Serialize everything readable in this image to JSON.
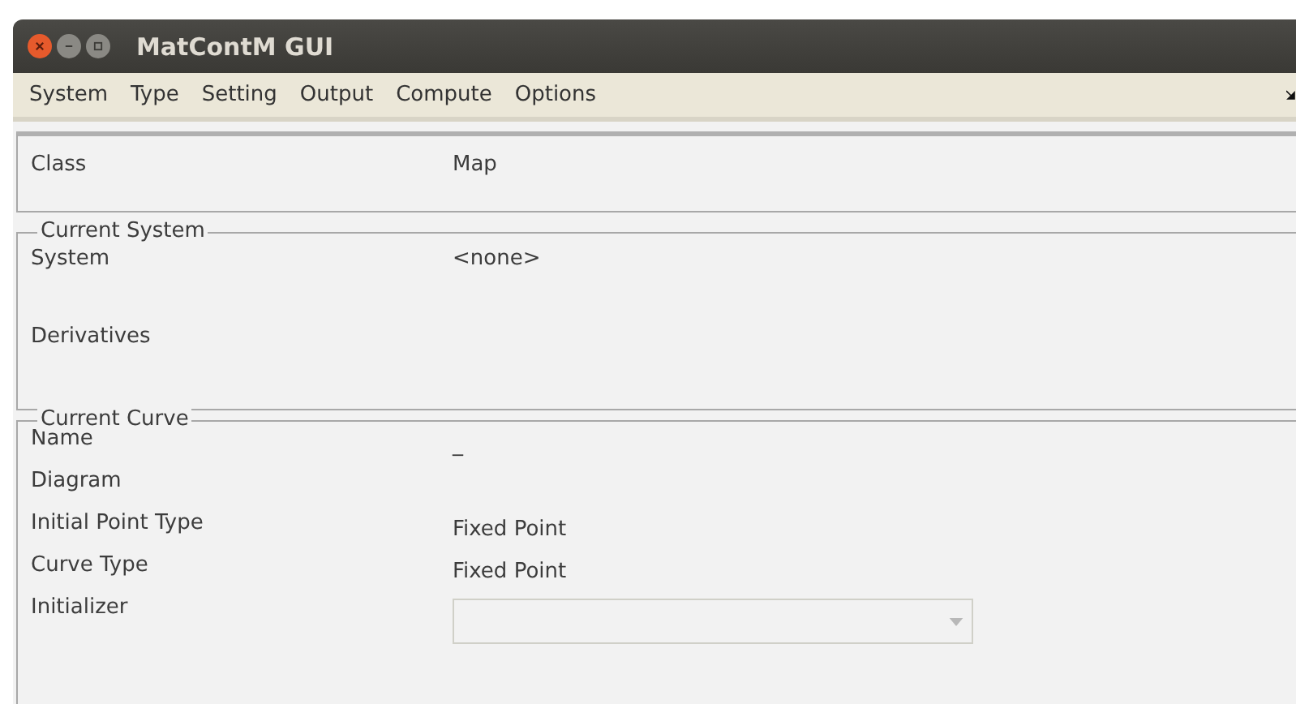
{
  "window": {
    "title": "MatContM GUI"
  },
  "menu": [
    {
      "label": "System"
    },
    {
      "label": "Type"
    },
    {
      "label": "Setting"
    },
    {
      "label": "Output"
    },
    {
      "label": "Compute"
    },
    {
      "label": "Options"
    }
  ],
  "class_panel": {
    "rows": [
      {
        "kind": "text",
        "label": "Class",
        "value": "Map"
      }
    ]
  },
  "current_system": {
    "title": "Current System",
    "rows": [
      {
        "kind": "text",
        "label": "System",
        "value": "<none>"
      },
      {
        "kind": "text",
        "label": "Derivatives"
      }
    ]
  },
  "current_curve": {
    "title": "Current Curve",
    "rows": [
      {
        "kind": "text",
        "label": "Name",
        "value": "_"
      },
      {
        "kind": "text",
        "label": "Diagram"
      },
      {
        "kind": "text",
        "label": "Initial Point Type",
        "value": "Fixed Point"
      },
      {
        "kind": "text",
        "label": "Curve Type",
        "value": "Fixed Point"
      },
      {
        "kind": "dropdown",
        "label": "Initializer",
        "disabled": true
      }
    ]
  }
}
